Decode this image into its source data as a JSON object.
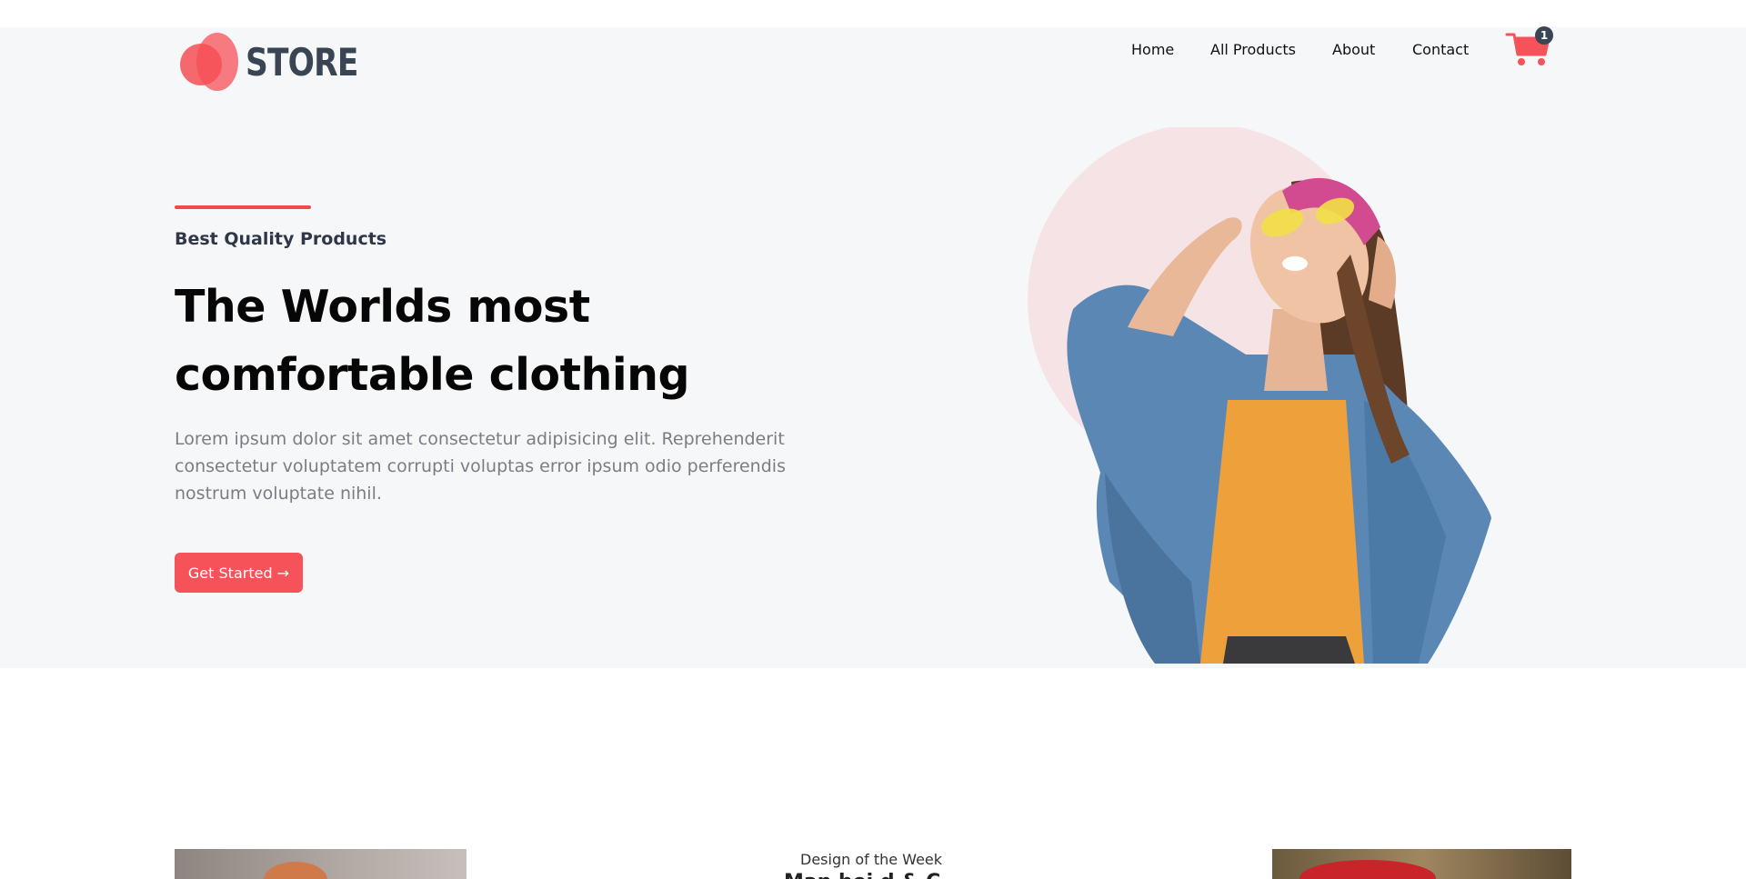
{
  "brand": {
    "name": "STORE",
    "accent": "#f5525a",
    "dark": "#3a4553"
  },
  "nav": {
    "home": "Home",
    "all_products": "All Products",
    "about": "About",
    "contact": "Contact"
  },
  "cart": {
    "icon": "shopping-cart-icon",
    "count": "1"
  },
  "hero": {
    "eyebrow": "Best Quality Products",
    "title_line1": "The Worlds most",
    "title_line2": "comfortable clothing",
    "description": "Lorem ipsum dolor sit amet consectetur adipisicing elit. Reprehenderit consectetur voluptatem corrupti voluptas error ipsum odio perferendis nostrum voluptate nihil.",
    "cta_label": "Get Started →"
  },
  "featured": {
    "label": "Design of the Week",
    "title": "Man hei d & C"
  }
}
